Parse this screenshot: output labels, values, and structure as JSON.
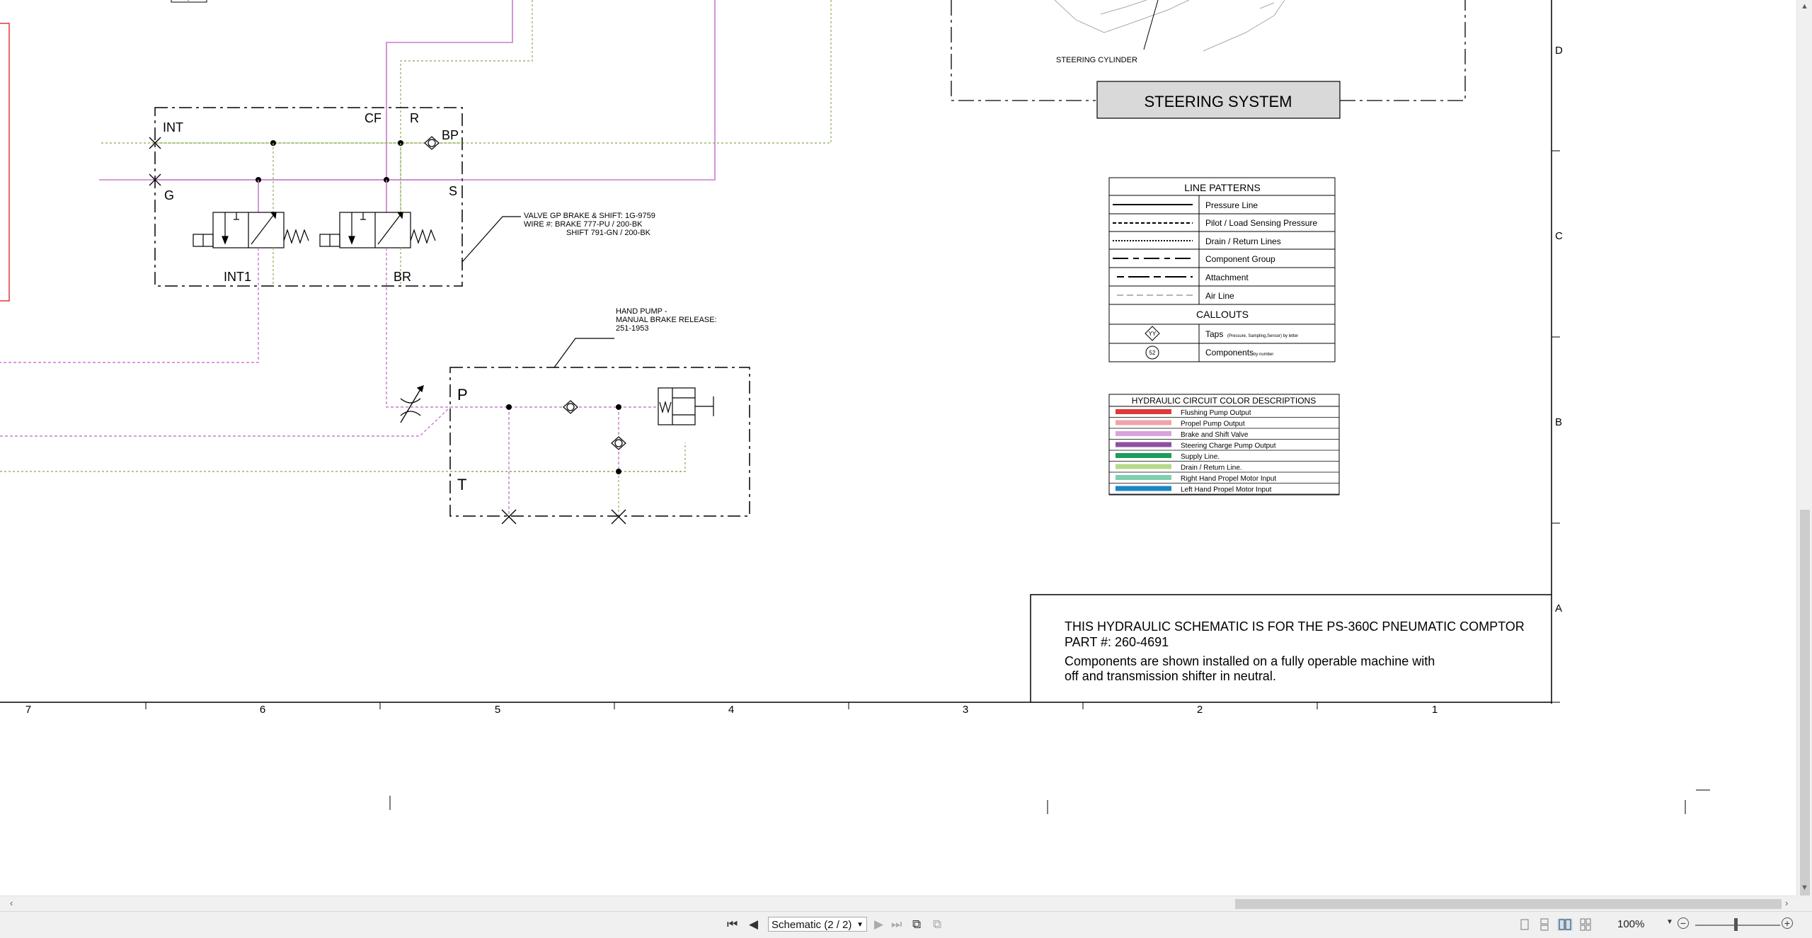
{
  "drawing": {
    "valve": {
      "ports": {
        "int": "INT",
        "cf": "CF",
        "r": "R",
        "bp": "BP",
        "g": "G",
        "s": "S",
        "int1": "INT1",
        "br": "BR"
      },
      "note_line1": "VALVE GP BRAKE & SHIFT: 1G-9759",
      "note_line2": "WIRE #:     BRAKE 777-PU / 200-BK",
      "note_line3": "SHIFT  791-GN / 200-BK"
    },
    "hand_pump": {
      "note_line1": "HAND PUMP -",
      "note_line2": "MANUAL BRAKE RELEASE:",
      "note_line3": "251-1953",
      "port_p": "P",
      "port_t": "T"
    },
    "steering": {
      "cylinder_label": "STEERING CYLINDER",
      "title": "STEERING SYSTEM"
    },
    "line_patterns": {
      "title": "LINE PATTERNS",
      "rows": [
        "Pressure Line",
        "Pilot / Load Sensing Pressure",
        "Drain / Return Lines",
        "Component Group",
        "Attachment",
        "Air Line"
      ],
      "callouts_title": "CALLOUTS",
      "tap_symbol": "YY",
      "tap_label": "Taps",
      "tap_sub": "(Pressure, Sampling,Sensor) by letter",
      "component_symbol": "52",
      "component_label": "Components",
      "component_sub": "by number"
    },
    "color_desc": {
      "title": "HYDRAULIC CIRCUIT COLOR DESCRIPTIONS",
      "rows": [
        {
          "label": "Flushing Pump Output",
          "color": "#e0393a"
        },
        {
          "label": " Propel Pump Output",
          "color": "#f0a4a8"
        },
        {
          "label": "Brake and Shift Valve",
          "color": "#d9a3dc"
        },
        {
          "label": "Steering Charge Pump Output",
          "color": "#8e4fa0"
        },
        {
          "label": "Supply Line.",
          "color": "#1e9a5a"
        },
        {
          "label": "Drain / Return Line.",
          "color": "#b6d98a"
        },
        {
          "label": "Right Hand Propel Motor Input",
          "color": "#7fcfae"
        },
        {
          "label": "Left Hand Propel Motor Input",
          "color": "#1c84c6"
        }
      ]
    },
    "title_block": {
      "line1": "THIS HYDRAULIC SCHEMATIC IS FOR THE PS-360C PNEUMATIC COMPTOR",
      "line2": "PART #: 260-4691",
      "line3": "Components are shown installed on a fully operable machine with",
      "line4": "off and transmission shifter in neutral."
    },
    "zone_letters": [
      "D",
      "C",
      "B",
      "A"
    ],
    "zone_numbers": [
      "7",
      "6",
      "5",
      "4",
      "3",
      "2",
      "1"
    ],
    "colors": {
      "brake_line": "#c87bcf",
      "drain_line": "#9ab86a",
      "propel_line": "#d88fd8",
      "border_red": "#e0393a"
    }
  },
  "statusbar": {
    "page_selector": "Schematic (2 / 2)",
    "zoom": "100%",
    "icons": [
      "first-page-icon",
      "previous-page-icon",
      "next-page-icon",
      "last-page-icon",
      "previous-view-icon",
      "next-view-icon"
    ]
  }
}
